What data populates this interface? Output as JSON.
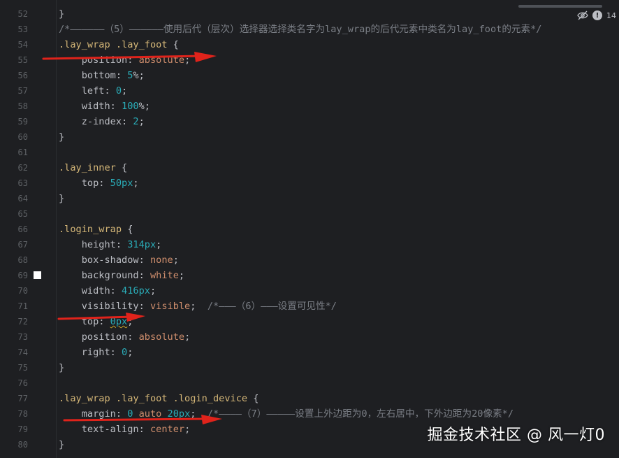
{
  "editor": {
    "lines": [
      {
        "n": "52",
        "tokens": [
          [
            "punc",
            "}"
          ]
        ]
      },
      {
        "n": "53",
        "tokens": [
          [
            "cmt",
            "/*——————（5）——————使用后代（层次）选择器选择类名字为lay_wrap的后代元素中类名为lay_foot的元素*/"
          ]
        ]
      },
      {
        "n": "54",
        "tokens": [
          [
            "sel",
            ".lay_wrap .lay_foot"
          ],
          [
            "punc",
            " {"
          ]
        ]
      },
      {
        "n": "55",
        "tokens": [
          [
            "prop",
            "    position"
          ],
          [
            "punc",
            ": "
          ],
          [
            "kw",
            "absolute"
          ],
          [
            "punc",
            ";"
          ]
        ]
      },
      {
        "n": "56",
        "tokens": [
          [
            "prop",
            "    bottom"
          ],
          [
            "punc",
            ": "
          ],
          [
            "num",
            "5"
          ],
          [
            "punc",
            "%;"
          ]
        ]
      },
      {
        "n": "57",
        "tokens": [
          [
            "prop",
            "    left"
          ],
          [
            "punc",
            ": "
          ],
          [
            "num",
            "0"
          ],
          [
            "punc",
            ";"
          ]
        ]
      },
      {
        "n": "58",
        "tokens": [
          [
            "prop",
            "    width"
          ],
          [
            "punc",
            ": "
          ],
          [
            "num",
            "100"
          ],
          [
            "punc",
            "%;"
          ]
        ]
      },
      {
        "n": "59",
        "tokens": [
          [
            "prop",
            "    z-index"
          ],
          [
            "punc",
            ": "
          ],
          [
            "num",
            "2"
          ],
          [
            "punc",
            ";"
          ]
        ]
      },
      {
        "n": "60",
        "tokens": [
          [
            "punc",
            "}"
          ]
        ]
      },
      {
        "n": "61",
        "tokens": []
      },
      {
        "n": "62",
        "tokens": [
          [
            "sel",
            ".lay_inner"
          ],
          [
            "punc",
            " {"
          ]
        ]
      },
      {
        "n": "63",
        "tokens": [
          [
            "prop",
            "    top"
          ],
          [
            "punc",
            ": "
          ],
          [
            "num",
            "50px"
          ],
          [
            "punc",
            ";"
          ]
        ]
      },
      {
        "n": "64",
        "tokens": [
          [
            "punc",
            "}"
          ]
        ]
      },
      {
        "n": "65",
        "tokens": []
      },
      {
        "n": "66",
        "tokens": [
          [
            "sel",
            ".login_wrap"
          ],
          [
            "punc",
            " {"
          ]
        ]
      },
      {
        "n": "67",
        "tokens": [
          [
            "prop",
            "    height"
          ],
          [
            "punc",
            ": "
          ],
          [
            "num",
            "314px"
          ],
          [
            "punc",
            ";"
          ]
        ]
      },
      {
        "n": "68",
        "tokens": [
          [
            "prop",
            "    box-shadow"
          ],
          [
            "punc",
            ": "
          ],
          [
            "kw",
            "none"
          ],
          [
            "punc",
            ";"
          ]
        ]
      },
      {
        "n": "69",
        "marker": true,
        "tokens": [
          [
            "prop",
            "    background"
          ],
          [
            "punc",
            ": "
          ],
          [
            "kw",
            "white"
          ],
          [
            "punc",
            ";"
          ]
        ]
      },
      {
        "n": "70",
        "tokens": [
          [
            "prop",
            "    width"
          ],
          [
            "punc",
            ": "
          ],
          [
            "num",
            "416px"
          ],
          [
            "punc",
            ";"
          ]
        ]
      },
      {
        "n": "71",
        "tokens": [
          [
            "prop",
            "    visibility"
          ],
          [
            "punc",
            ": "
          ],
          [
            "kw",
            "visible"
          ],
          [
            "punc",
            ";  "
          ],
          [
            "cmt",
            "/*———（6）———设置可见性*/"
          ]
        ]
      },
      {
        "n": "72",
        "tokens": [
          [
            "prop",
            "    top"
          ],
          [
            "punc",
            ": "
          ],
          [
            "num squig",
            "0px"
          ],
          [
            "punc",
            ";"
          ]
        ]
      },
      {
        "n": "73",
        "tokens": [
          [
            "prop",
            "    position"
          ],
          [
            "punc",
            ": "
          ],
          [
            "kw",
            "absolute"
          ],
          [
            "punc",
            ";"
          ]
        ]
      },
      {
        "n": "74",
        "tokens": [
          [
            "prop",
            "    right"
          ],
          [
            "punc",
            ": "
          ],
          [
            "num",
            "0"
          ],
          [
            "punc",
            ";"
          ]
        ]
      },
      {
        "n": "75",
        "tokens": [
          [
            "punc",
            "}"
          ]
        ]
      },
      {
        "n": "76",
        "tokens": []
      },
      {
        "n": "77",
        "tokens": [
          [
            "sel",
            ".lay_wrap .lay_foot .login_device"
          ],
          [
            "punc",
            " {"
          ]
        ]
      },
      {
        "n": "78",
        "tokens": [
          [
            "prop",
            "    margin"
          ],
          [
            "punc",
            ": "
          ],
          [
            "num",
            "0"
          ],
          [
            "punc",
            " "
          ],
          [
            "kw",
            "auto"
          ],
          [
            "punc",
            " "
          ],
          [
            "num",
            "20px"
          ],
          [
            "punc",
            ";  "
          ],
          [
            "cmt",
            "/*————（7）—————设置上外边距为0，左右居中，下外边距为20像素*/"
          ]
        ]
      },
      {
        "n": "79",
        "tokens": [
          [
            "prop",
            "    text-align"
          ],
          [
            "punc",
            ": "
          ],
          [
            "kw",
            "center"
          ],
          [
            "punc",
            ";"
          ]
        ]
      },
      {
        "n": "80",
        "tokens": [
          [
            "punc",
            "}"
          ]
        ]
      }
    ]
  },
  "status": {
    "problems_count": "14",
    "icons": [
      "eye-crossed-icon",
      "warning-icon"
    ]
  },
  "watermark": "掘金技术社区 @ 风一灯0",
  "colors": {
    "background": "#1e1f22",
    "arrow": "#e0231b"
  }
}
